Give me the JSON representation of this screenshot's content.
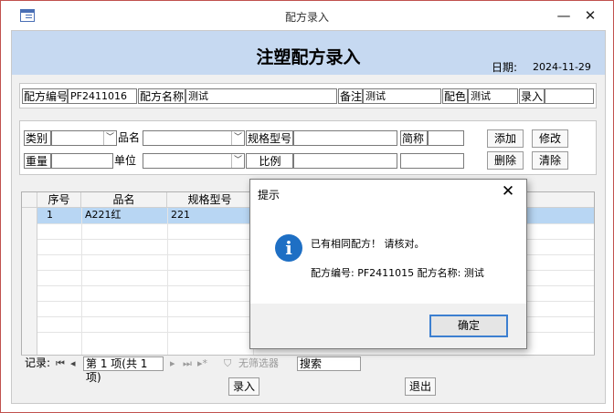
{
  "window": {
    "title": "配方录入",
    "minimize_label": "—",
    "close_label": "✕"
  },
  "header": {
    "title": "注塑配方录入",
    "date_label": "日期:",
    "date_value": "2024-11-29"
  },
  "recipe": {
    "code_label": "配方编号",
    "code_value": "PF2411016",
    "name_label": "配方名称",
    "name_value": "测试",
    "remark_label": "备注",
    "remark_value": "测试",
    "color_label": "配色",
    "color_value": "测试",
    "entry_label": "录入",
    "entry_value": ""
  },
  "item_form": {
    "category_label": "类别",
    "product_label": "品名",
    "spec_label": "规格型号",
    "short_label": "简称",
    "weight_label": "重量",
    "unit_label": "单位",
    "ratio_label": "比例",
    "add_label": "添加",
    "modify_label": "修改",
    "delete_label": "删除",
    "clear_label": "清除"
  },
  "grid": {
    "columns": [
      "序号",
      "品名",
      "规格型号"
    ],
    "rows": [
      {
        "seq": "1",
        "product": "A221红",
        "spec": "221"
      }
    ]
  },
  "navbar": {
    "record_label": "记录:",
    "position": "第 1 项(共 1 项)",
    "filter_label": "无筛选器",
    "search_label": "搜索"
  },
  "bottom": {
    "submit_label": "录入",
    "exit_label": "退出"
  },
  "dialog": {
    "title": "提示",
    "close_label": "✕",
    "icon_glyph": "i",
    "message": "已有相同配方！ 请核对。",
    "detail": "配方编号: PF2411015    配方名称: 测试",
    "ok_label": "确定"
  }
}
